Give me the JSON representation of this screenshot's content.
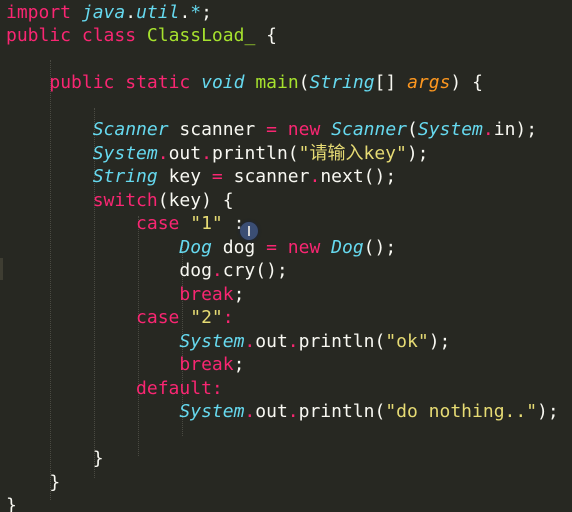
{
  "editor": {
    "theme_background": "#272822",
    "lines": [
      [
        [
          "kw",
          "import"
        ],
        [
          "pl",
          " "
        ],
        [
          "ty",
          "java"
        ],
        [
          "pl",
          "."
        ],
        [
          "ty",
          "util"
        ],
        [
          "pl",
          "."
        ],
        [
          "ty",
          "*"
        ],
        [
          "pl",
          ";"
        ]
      ],
      [
        [
          "kw",
          "public"
        ],
        [
          "pl",
          " "
        ],
        [
          "kw",
          "class"
        ],
        [
          "pl",
          " "
        ],
        [
          "fn",
          "ClassLoad_"
        ],
        [
          "pl",
          " {"
        ]
      ],
      [],
      [
        [
          "pl",
          "    "
        ],
        [
          "kw",
          "public"
        ],
        [
          "pl",
          " "
        ],
        [
          "kw",
          "static"
        ],
        [
          "pl",
          " "
        ],
        [
          "ty",
          "void"
        ],
        [
          "pl",
          " "
        ],
        [
          "fn",
          "main"
        ],
        [
          "pl",
          "("
        ],
        [
          "ty",
          "String"
        ],
        [
          "pl",
          "[] "
        ],
        [
          "pr",
          "args"
        ],
        [
          "pl",
          ") {"
        ]
      ],
      [],
      [
        [
          "pl",
          "        "
        ],
        [
          "ty",
          "Scanner"
        ],
        [
          "pl",
          " scanner "
        ],
        [
          "op",
          "="
        ],
        [
          "pl",
          " "
        ],
        [
          "kw",
          "new"
        ],
        [
          "pl",
          " "
        ],
        [
          "ty",
          "Scanner"
        ],
        [
          "pl",
          "("
        ],
        [
          "ty",
          "System"
        ],
        [
          "op",
          "."
        ],
        [
          "pl",
          "in);"
        ]
      ],
      [
        [
          "pl",
          "        "
        ],
        [
          "ty",
          "System"
        ],
        [
          "op",
          "."
        ],
        [
          "pl",
          "out"
        ],
        [
          "op",
          "."
        ],
        [
          "pl",
          "println("
        ],
        [
          "st",
          "\"请输入key\""
        ],
        [
          "pl",
          ");"
        ]
      ],
      [
        [
          "pl",
          "        "
        ],
        [
          "ty",
          "String"
        ],
        [
          "pl",
          " key "
        ],
        [
          "op",
          "="
        ],
        [
          "pl",
          " scanner"
        ],
        [
          "op",
          "."
        ],
        [
          "pl",
          "next();"
        ]
      ],
      [
        [
          "pl",
          "        "
        ],
        [
          "kw",
          "switch"
        ],
        [
          "pl",
          "(key) {"
        ]
      ],
      [
        [
          "pl",
          "            "
        ],
        [
          "kw",
          "case"
        ],
        [
          "pl",
          " "
        ],
        [
          "st",
          "\"1\""
        ],
        [
          "pl",
          " :"
        ]
      ],
      [
        [
          "pl",
          "                "
        ],
        [
          "ty",
          "Dog"
        ],
        [
          "pl",
          " dog "
        ],
        [
          "op",
          "="
        ],
        [
          "pl",
          " "
        ],
        [
          "kw",
          "new"
        ],
        [
          "pl",
          " "
        ],
        [
          "ty",
          "Dog"
        ],
        [
          "pl",
          "();"
        ]
      ],
      [
        [
          "pl",
          "                dog"
        ],
        [
          "op",
          "."
        ],
        [
          "pl",
          "cry();"
        ]
      ],
      [
        [
          "pl",
          "                "
        ],
        [
          "kw",
          "break"
        ],
        [
          "pl",
          ";"
        ]
      ],
      [
        [
          "pl",
          "            "
        ],
        [
          "kw",
          "case"
        ],
        [
          "pl",
          " "
        ],
        [
          "st",
          "\"2\""
        ],
        [
          "kw",
          ":"
        ]
      ],
      [
        [
          "pl",
          "                "
        ],
        [
          "ty",
          "System"
        ],
        [
          "op",
          "."
        ],
        [
          "pl",
          "out"
        ],
        [
          "op",
          "."
        ],
        [
          "pl",
          "println("
        ],
        [
          "st",
          "\"ok\""
        ],
        [
          "pl",
          ");"
        ]
      ],
      [
        [
          "pl",
          "                "
        ],
        [
          "kw",
          "break"
        ],
        [
          "pl",
          ";"
        ]
      ],
      [
        [
          "pl",
          "            "
        ],
        [
          "kw",
          "default"
        ],
        [
          "kw",
          ":"
        ]
      ],
      [
        [
          "pl",
          "                "
        ],
        [
          "ty",
          "System"
        ],
        [
          "op",
          "."
        ],
        [
          "pl",
          "out"
        ],
        [
          "op",
          "."
        ],
        [
          "pl",
          "println("
        ],
        [
          "st",
          "\"do nothing..\""
        ],
        [
          "pl",
          ");"
        ]
      ],
      [],
      [
        [
          "pl",
          "        }"
        ]
      ],
      [
        [
          "pl",
          "    }"
        ]
      ],
      [
        [
          "pl",
          "}"
        ]
      ]
    ]
  }
}
